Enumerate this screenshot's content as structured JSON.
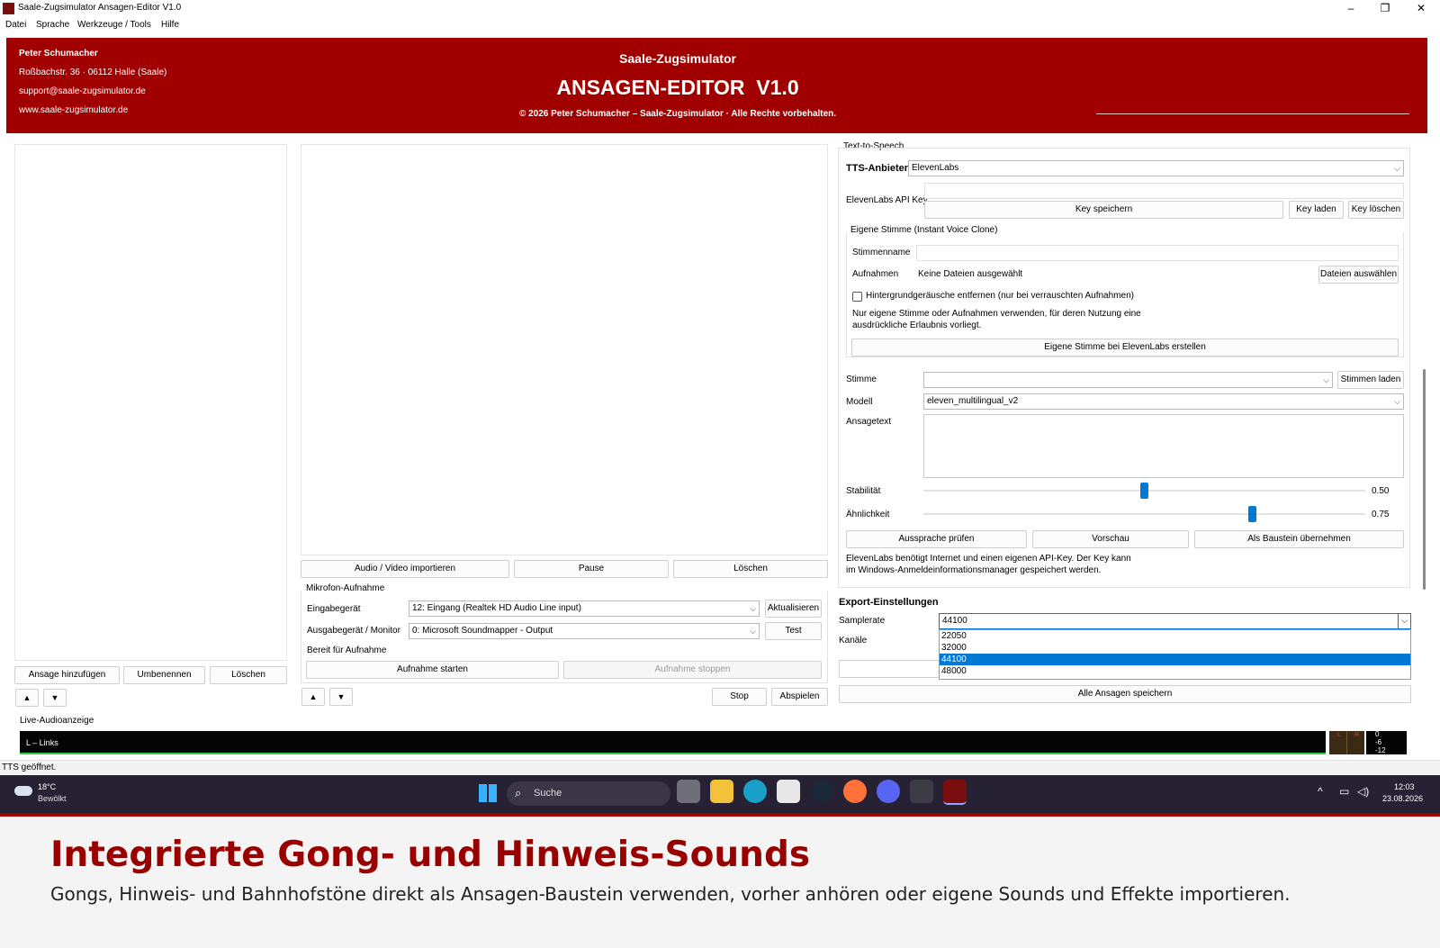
{
  "window": {
    "title": "Saale-Zugsimulator Ansagen-Editor V1.0"
  },
  "menu": [
    "Datei",
    "Sprache",
    "Werkzeuge / Tools",
    "Hilfe"
  ],
  "header": {
    "name": "Peter Schumacher",
    "address": "Roßbachstr. 36 · 06112 Halle (Saale)",
    "email": "support@saale-zugsimulator.de",
    "web": "www.saale-zugsimulator.de",
    "app": "Saale-Zugsimulator",
    "title": "ANSAGEN-EDITOR  V1.0",
    "copyright": "© 2026 Peter Schumacher – Saale-Zugsimulator · Alle Rechte vorbehalten."
  },
  "left": {
    "add": "Ansage hinzufügen",
    "rename": "Umbenennen",
    "delete": "Löschen",
    "up": "▲",
    "down": "▼"
  },
  "middle": {
    "import": "Audio / Video importieren",
    "pause": "Pause",
    "delete": "Löschen",
    "mic_group": "Mikrofon-Aufnahme",
    "input_label": "Eingabegerät",
    "input_value": "12: Eingang (Realtek HD Audio Line input)",
    "refresh": "Aktualisieren",
    "output_label": "Ausgabegerät / Monitor",
    "output_value": "0: Microsoft Soundmapper - Output",
    "test": "Test",
    "ready": "Bereit für Aufnahme",
    "rec_start": "Aufnahme starten",
    "rec_stop": "Aufnahme stoppen",
    "up": "▲",
    "down": "▼",
    "stop": "Stop",
    "play": "Abspielen"
  },
  "tts": {
    "group": "Text-to-Speech",
    "provider_label": "TTS-Anbieter",
    "provider_value": "ElevenLabs",
    "api_label": "ElevenLabs API Key",
    "key_save": "Key speichern",
    "key_load": "Key laden",
    "key_delete": "Key löschen",
    "clone_group": "Eigene Stimme (Instant Voice Clone)",
    "voice_name_label": "Stimmenname",
    "recordings_label": "Aufnahmen",
    "recordings_value": "Keine Dateien ausgewählt",
    "choose_files": "Dateien auswählen",
    "noise_check": "Hintergrundgeräusche entfernen (nur bei verrauschten Aufnahmen)",
    "notice_line1": "Nur eigene Stimme oder Aufnahmen verwenden, für deren Nutzung eine",
    "notice_line2": "ausdrückliche Erlaubnis vorliegt.",
    "create_voice": "Eigene Stimme bei ElevenLabs erstellen",
    "voice_label": "Stimme",
    "voices_load": "Stimmen laden",
    "model_label": "Modell",
    "model_value": "eleven_multilingual_v2",
    "text_label": "Ansagetext",
    "stability_label": "Stabilität",
    "stability_value": "0.50",
    "stability_level": 0.5,
    "similarity_label": "Ähnlichkeit",
    "similarity_value": "0.75",
    "similarity_level": 0.75,
    "check_pron": "Aussprache prüfen",
    "preview": "Vorschau",
    "as_block": "Als Baustein übernehmen",
    "info_line1": "ElevenLabs benötigt Internet und einen eigenen API-Key. Der Key kann",
    "info_line2": "im Windows-Anmeldeinformationsmanager gespeichert werden."
  },
  "export": {
    "title": "Export-Einstellungen",
    "samplerate_label": "Samplerate",
    "samplerate_value": "44100",
    "options": [
      "22050",
      "32000",
      "44100",
      "48000"
    ],
    "selected_index": 2,
    "channels_label": "Kanäle",
    "save_all": "Alle Ansagen speichern"
  },
  "meter": {
    "label": "Live-Audioanzeige",
    "channel": "L – Links",
    "l": "L",
    "r": "R",
    "scale": [
      "0",
      "-6",
      "-12"
    ]
  },
  "status": "TTS geöffnet.",
  "taskbar": {
    "temp": "18°C",
    "weather": "Bewölkt",
    "search": "Suche",
    "time": "12:03",
    "date": "23.08.2026"
  },
  "caption": {
    "title": "Integrierte Gong- und Hinweis-Sounds",
    "text": "Gongs, Hinweis- und Bahnhofstöne direkt als Ansagen-Baustein verwenden, vorher anhören oder eigene Sounds und Effekte importieren."
  },
  "colors": {
    "header_bg": "#a00000",
    "accent": "#0078d4",
    "caption_title": "#990000",
    "taskbar": "#262233"
  }
}
